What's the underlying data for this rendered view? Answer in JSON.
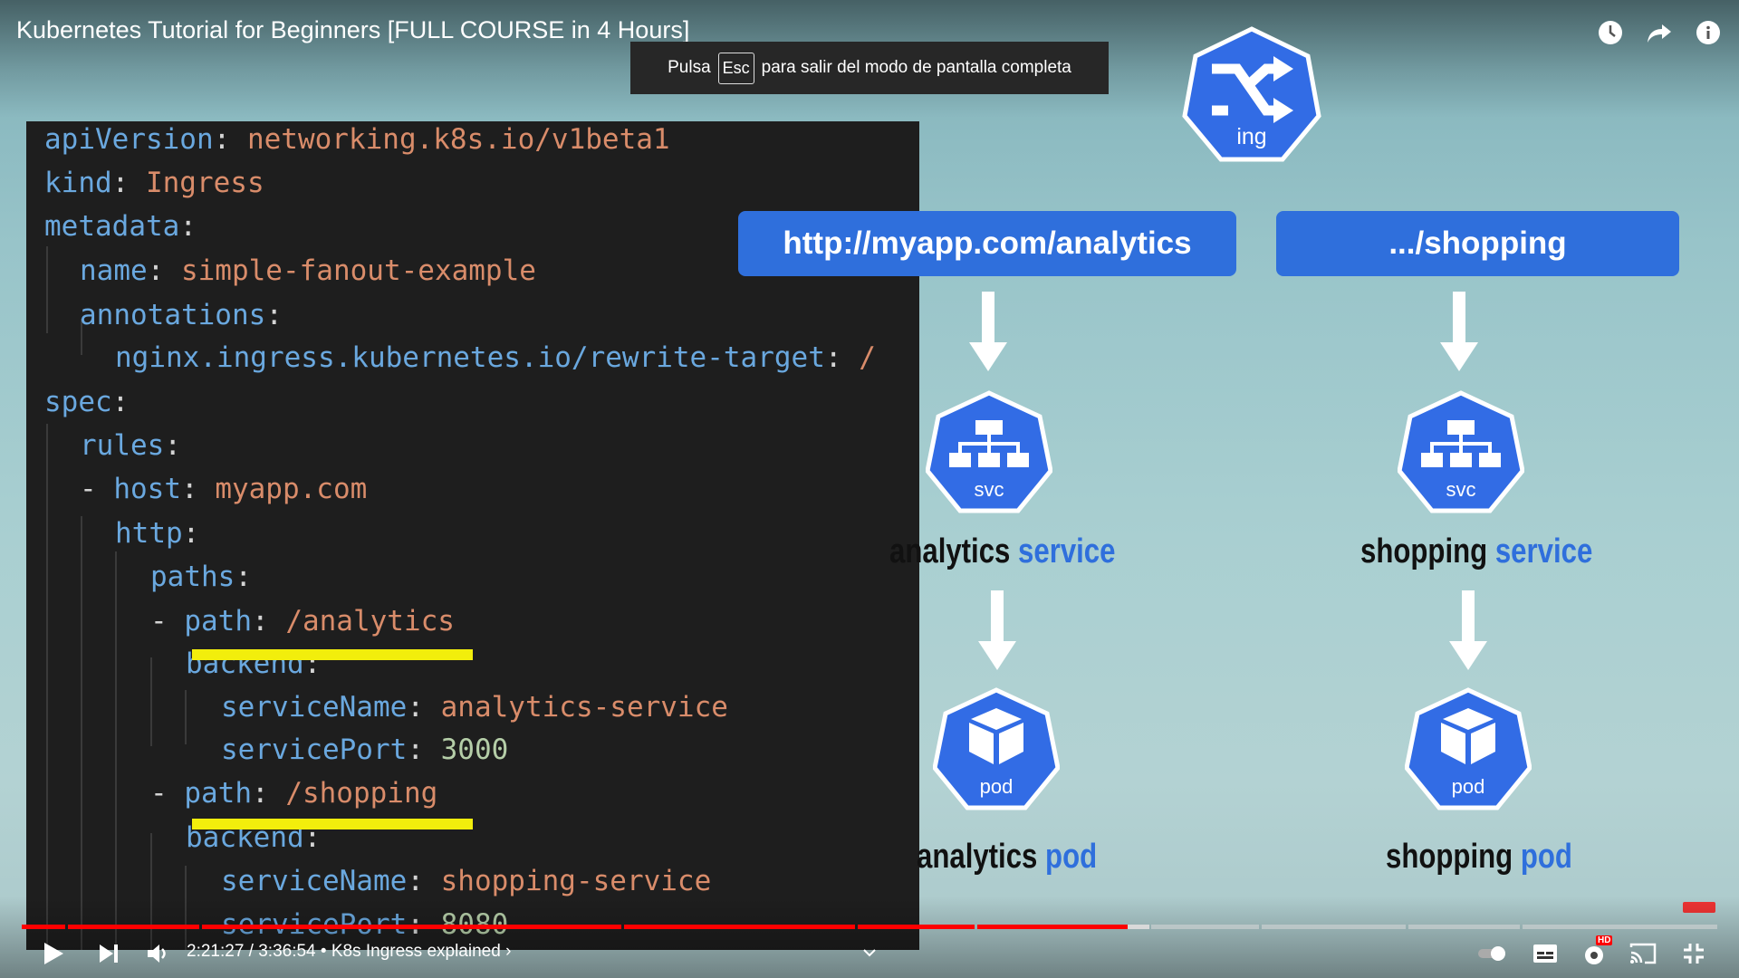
{
  "video": {
    "title": "Kubernetes Tutorial for Beginners [FULL COURSE in 4 Hours]"
  },
  "fullscreen_toast": {
    "before": "Pulsa",
    "key": "Esc",
    "after": "para salir del modo de pantalla completa"
  },
  "top_icons": [
    "watch-later-icon",
    "share-icon",
    "info-icon"
  ],
  "code": {
    "lines": [
      {
        "key": "apiVersion",
        "value": "networking.k8s.io/v1beta1"
      },
      {
        "key": "kind",
        "value": "Ingress"
      },
      {
        "key": "metadata",
        "value": ""
      },
      {
        "key": "name",
        "value": "simple-fanout-example"
      },
      {
        "key": "annotations",
        "value": ""
      },
      {
        "key": "nginx.ingress.kubernetes.io/rewrite-target",
        "value": "/"
      },
      {
        "key": "spec",
        "value": ""
      },
      {
        "key": "rules",
        "value": ""
      },
      {
        "dash": "- ",
        "key": "host",
        "value": "myapp.com"
      },
      {
        "key": "http",
        "value": ""
      },
      {
        "key": "paths",
        "value": ""
      },
      {
        "dash": "- ",
        "key": "path",
        "value": "/analytics"
      },
      {
        "key": "backend",
        "value": ""
      },
      {
        "key": "serviceName",
        "value": "analytics-service"
      },
      {
        "key": "servicePort",
        "value": "3000"
      },
      {
        "dash": "- ",
        "key": "path",
        "value": "/shopping"
      },
      {
        "key": "backend",
        "value": ""
      },
      {
        "key": "serviceName",
        "value": "shopping-service"
      },
      {
        "key": "servicePort",
        "value": "8080"
      }
    ]
  },
  "diagram": {
    "ingress_label": "ing",
    "left": {
      "url": "http://myapp.com/analytics",
      "svc_icon_label": "svc",
      "service_name": "analytics",
      "service_word": "service",
      "pod_icon_label": "pod",
      "pod_name": "analytics",
      "pod_word": "pod"
    },
    "right": {
      "url": ".../shopping",
      "svc_icon_label": "svc",
      "service_name": "shopping",
      "service_word": "service",
      "pod_icon_label": "pod",
      "pod_name": "shopping",
      "pod_word": "pod"
    }
  },
  "player": {
    "time": "2:21:27 / 3:36:54",
    "separator": "•",
    "chapter": "K8s Ingress explained",
    "chapter_chevron": "›",
    "progress_fraction": 0.652,
    "hd_badge": "HD",
    "colors": {
      "played": "#ff0000",
      "unplayed": "#d9d9d9",
      "accent": "#2f6fdc"
    }
  }
}
